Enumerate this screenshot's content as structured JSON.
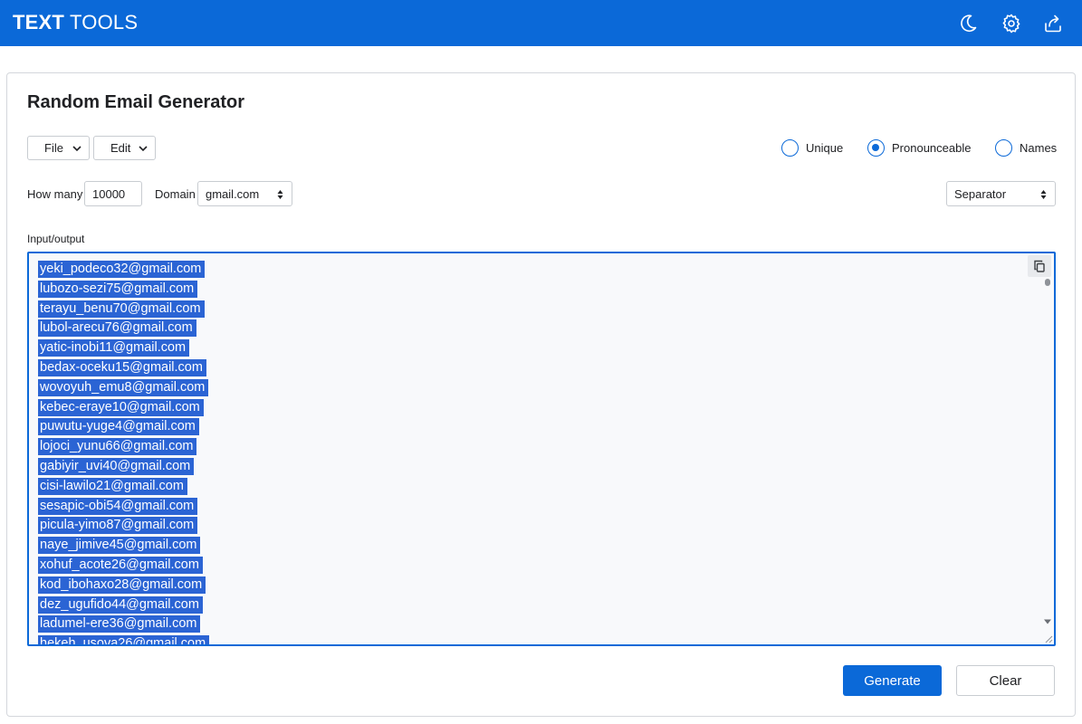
{
  "header": {
    "brand_bold": "TEXT",
    "brand_light": "TOOLS",
    "icons": [
      "moon-icon",
      "gear-icon",
      "share-icon"
    ]
  },
  "page": {
    "title": "Random Email Generator"
  },
  "menus": {
    "file_label": "File",
    "edit_label": "Edit"
  },
  "modes": [
    {
      "label": "Unique",
      "selected": false
    },
    {
      "label": "Pronounceable",
      "selected": true
    },
    {
      "label": "Names",
      "selected": false
    }
  ],
  "options": {
    "how_many_label": "How many",
    "how_many_value": "10000",
    "domain_label": "Domain",
    "domain_value": "gmail.com",
    "separator_value": "Separator"
  },
  "io": {
    "label": "Input/output",
    "lines": [
      "yeki_podeco32@gmail.com",
      "lubozo-sezi75@gmail.com",
      "terayu_benu70@gmail.com",
      "lubol-arecu76@gmail.com",
      "yatic-inobi11@gmail.com",
      "bedax-oceku15@gmail.com",
      "wovoyuh_emu8@gmail.com",
      "kebec-eraye10@gmail.com",
      "puwutu-yuge4@gmail.com",
      "lojoci_yunu66@gmail.com",
      "gabiyir_uvi40@gmail.com",
      "cisi-lawilo21@gmail.com",
      "sesapic-obi54@gmail.com",
      "picula-yimo87@gmail.com",
      "naye_jimive45@gmail.com",
      "xohuf_acote26@gmail.com",
      "kod_ibohaxo28@gmail.com",
      "dez_ugufido44@gmail.com",
      "ladumel-ere36@gmail.com",
      "hekeh_usova26@gmail.com"
    ]
  },
  "actions": {
    "generate_label": "Generate",
    "clear_label": "Clear"
  },
  "colors": {
    "accent": "#0b69d8",
    "selection": "#2b64d4"
  }
}
